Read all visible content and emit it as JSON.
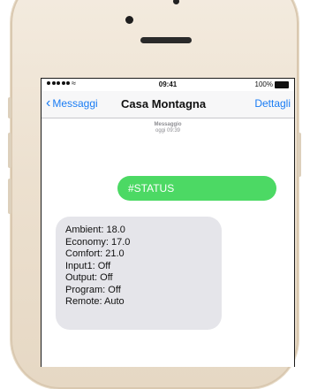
{
  "statusbar": {
    "time": "09:41",
    "battery": "100%"
  },
  "nav": {
    "back_label": "Messaggi",
    "title": "Casa Montagna",
    "details_label": "Dettagli"
  },
  "meta": {
    "service": "Messaggio",
    "timestamp": "oggi 09:39"
  },
  "messages": {
    "outgoing": "#STATUS",
    "incoming": [
      "Ambient: 18.0",
      "Economy: 17.0",
      "Comfort: 21.0",
      "Input1: Off",
      "Output: Off",
      "Program: Off",
      "Remote: Auto"
    ]
  },
  "colors": {
    "accent": "#1a7cf4",
    "outgoing_bubble": "#4cd964",
    "incoming_bubble": "#e5e5ea"
  }
}
